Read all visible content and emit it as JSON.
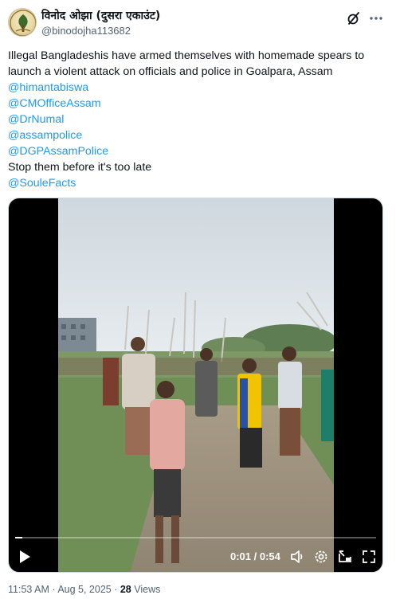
{
  "author": {
    "display_name": "विनोद ओझा (दुसरा एकाउंट)",
    "handle": "@binodojha113682"
  },
  "header_icons": {
    "grok": "grok-icon",
    "more": "more-options-icon"
  },
  "tweet": {
    "lines": [
      "Illegal Bangladeshis have armed themselves with homemade spears to",
      "launch a violent attack on officials and police in Goalpara, Assam"
    ],
    "mentions": [
      "@himantabiswa",
      "@CMOfficeAssam",
      "@DrNumal",
      "@assampolice",
      "@DGPAssamPolice"
    ],
    "closing_line": "Stop them before it's too late",
    "final_mention": "@SouleFacts"
  },
  "video": {
    "current_time": "0:01",
    "duration": "0:54",
    "time_display": "0:01 / 0:54",
    "progress_fraction": 0.02,
    "icons": [
      "play-icon",
      "volume-icon",
      "settings-icon",
      "pip-icon",
      "fullscreen-icon"
    ]
  },
  "meta": {
    "time": "11:53 AM",
    "date": "Aug 5, 2025",
    "separator": " · ",
    "views_count": "28",
    "views_label": " Views"
  },
  "colors": {
    "link": "#1d9bf0",
    "secondary_text": "#536471",
    "primary_text": "#0f1419"
  }
}
